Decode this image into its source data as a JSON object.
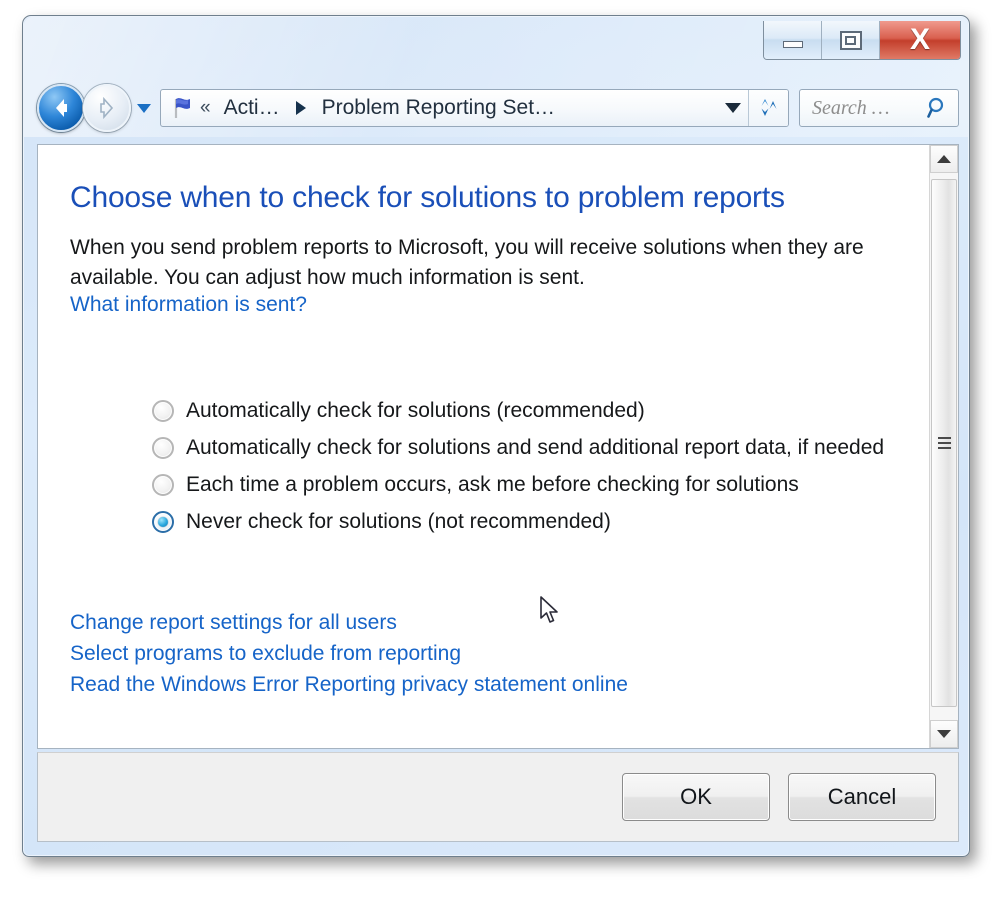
{
  "window": {
    "caption_buttons": [
      {
        "name": "minimize",
        "label": "Minimize"
      },
      {
        "name": "maximize",
        "label": "Maximize"
      },
      {
        "name": "close",
        "label": "X"
      }
    ]
  },
  "navbar": {
    "back_label": "Back",
    "forward_label": "Forward",
    "recent_pages_label": "Recent pages",
    "breadcrumb": {
      "icon": "flag-icon",
      "overflow": "«",
      "items": [
        {
          "label": "Acti…"
        },
        {
          "label": "Problem Reporting Set…"
        }
      ],
      "dropdown_label": "Previous locations"
    },
    "refresh_label": "Refresh",
    "search": {
      "placeholder": "Search …",
      "value": "",
      "icon": "search-icon"
    }
  },
  "content": {
    "page_title": "Choose when to check for solutions to problem reports",
    "paragraph": "When you send problem reports to Microsoft, you will receive solutions when they are available. You can adjust how much information is sent.",
    "info_link": "What information is sent?",
    "radio_options": [
      {
        "label": "Automatically check for solutions (recommended)",
        "checked": false
      },
      {
        "label": "Automatically check for solutions and send additional report data, if needed",
        "checked": false
      },
      {
        "label": "Each time a problem occurs, ask me before checking for solutions",
        "checked": false
      },
      {
        "label": "Never check for solutions (not recommended)",
        "checked": true
      }
    ],
    "bottom_links": [
      "Change report settings for all users",
      "Select programs to exclude from reporting",
      "Read the Windows Error Reporting privacy statement online"
    ]
  },
  "scrollbar": {
    "up_label": "Scroll up",
    "down_label": "Scroll down",
    "thumb_label": "Scroll thumb"
  },
  "footer": {
    "ok_label": "OK",
    "cancel_label": "Cancel"
  },
  "colors": {
    "title_blue": "#1a4fb8",
    "link_blue": "#1664c8",
    "glass_blue": "#d9e9fa",
    "close_red": "#c33f2c",
    "radio_accent": "#29a8de"
  }
}
